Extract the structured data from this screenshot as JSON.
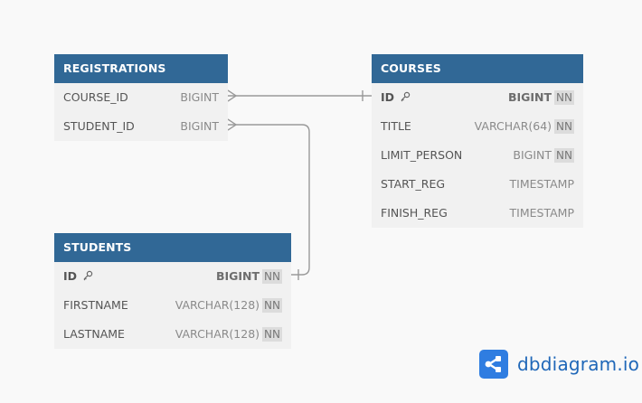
{
  "tables": {
    "registrations": {
      "title": "REGISTRATIONS",
      "fields": [
        {
          "name": "COURSE_ID",
          "type": "BIGINT"
        },
        {
          "name": "STUDENT_ID",
          "type": "BIGINT"
        }
      ]
    },
    "courses": {
      "title": "COURSES",
      "fields": [
        {
          "name": "ID",
          "type": "BIGINT",
          "nn": "NN",
          "pk": true
        },
        {
          "name": "TITLE",
          "type": "VARCHAR(64)",
          "nn": "NN"
        },
        {
          "name": "LIMIT_PERSON",
          "type": "BIGINT",
          "nn": "NN"
        },
        {
          "name": "START_REG",
          "type": "TIMESTAMP"
        },
        {
          "name": "FINISH_REG",
          "type": "TIMESTAMP"
        }
      ]
    },
    "students": {
      "title": "STUDENTS",
      "fields": [
        {
          "name": "ID",
          "type": "BIGINT",
          "nn": "NN",
          "pk": true
        },
        {
          "name": "FIRSTNAME",
          "type": "VARCHAR(128)",
          "nn": "NN"
        },
        {
          "name": "LASTNAME",
          "type": "VARCHAR(128)",
          "nn": "NN"
        }
      ]
    }
  },
  "relations": [
    {
      "from": "REGISTRATIONS.COURSE_ID",
      "to": "COURSES.ID",
      "type": "many-to-one"
    },
    {
      "from": "REGISTRATIONS.STUDENT_ID",
      "to": "STUDENTS.ID",
      "type": "many-to-one"
    }
  ],
  "brand": {
    "name": "dbdiagram.io",
    "color": "#2f7de1"
  },
  "colors": {
    "header": "#316896",
    "body": "#f1f1f1",
    "connector": "#9a9a9a"
  }
}
